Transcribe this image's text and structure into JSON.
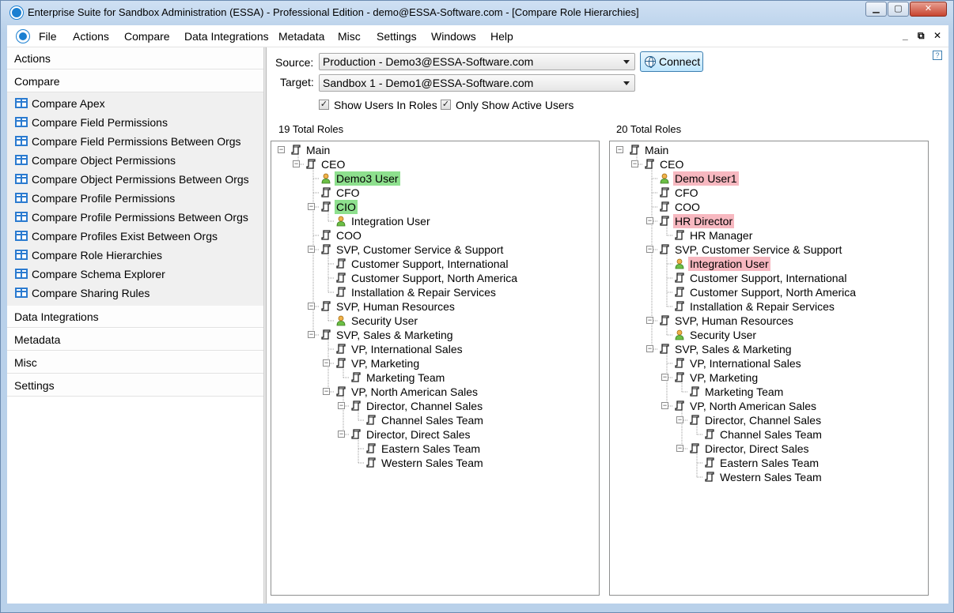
{
  "window": {
    "title": "Enterprise Suite for Sandbox Administration (ESSA) - Professional Edition - demo@ESSA-Software.com - [Compare Role Hierarchies]",
    "controls": {
      "minimize": "▁",
      "maximize": "▢",
      "close": "✕"
    }
  },
  "menubar": {
    "items": [
      "File",
      "Actions",
      "Compare",
      "Data Integrations",
      "Metadata",
      "Misc",
      "Settings",
      "Windows",
      "Help"
    ],
    "mdi_controls": [
      "_",
      "⧉",
      "✕"
    ]
  },
  "nav": {
    "headers": [
      "Actions",
      "Compare",
      "Data Integrations",
      "Metadata",
      "Misc",
      "Settings"
    ],
    "compare_items": [
      "Compare Apex",
      "Compare Field Permissions",
      "Compare Field Permissions Between Orgs",
      "Compare Object Permissions",
      "Compare Object Permissions Between Orgs",
      "Compare Profile Permissions",
      "Compare Profile Permissions Between Orgs",
      "Compare Profiles Exist Between Orgs",
      "Compare Role Hierarchies",
      "Compare Schema Explorer",
      "Compare Sharing Rules"
    ]
  },
  "form": {
    "source_label": "Source:",
    "source_value": "Production - Demo3@ESSA-Software.com",
    "target_label": "Target:",
    "target_value": "Sandbox 1 - Demo1@ESSA-Software.com",
    "connect_label": "Connect",
    "help": "?",
    "show_users_label": "Show Users In Roles",
    "show_users_checked": true,
    "only_active_label": "Only Show Active Users",
    "only_active_checked": true
  },
  "left_tree": {
    "count": "19 Total Roles",
    "nodes": [
      {
        "label": "Main",
        "level": 0,
        "type": "role",
        "expanded": true
      },
      {
        "label": "CEO",
        "level": 1,
        "type": "role",
        "expanded": true
      },
      {
        "label": "Demo3 User",
        "level": 2,
        "type": "user",
        "highlight": "green"
      },
      {
        "label": "CFO",
        "level": 2,
        "type": "role"
      },
      {
        "label": "CIO",
        "level": 2,
        "type": "role",
        "expanded": true,
        "highlight": "green"
      },
      {
        "label": "Integration User",
        "level": 3,
        "type": "user"
      },
      {
        "label": "COO",
        "level": 2,
        "type": "role"
      },
      {
        "label": "SVP, Customer Service & Support",
        "level": 2,
        "type": "role",
        "expanded": true
      },
      {
        "label": "Customer Support, International",
        "level": 3,
        "type": "role"
      },
      {
        "label": "Customer Support, North America",
        "level": 3,
        "type": "role"
      },
      {
        "label": "Installation & Repair Services",
        "level": 3,
        "type": "role"
      },
      {
        "label": "SVP, Human Resources",
        "level": 2,
        "type": "role",
        "expanded": true
      },
      {
        "label": "Security User",
        "level": 3,
        "type": "user"
      },
      {
        "label": "SVP, Sales & Marketing",
        "level": 2,
        "type": "role",
        "expanded": true
      },
      {
        "label": "VP, International Sales",
        "level": 3,
        "type": "role"
      },
      {
        "label": "VP, Marketing",
        "level": 3,
        "type": "role",
        "expanded": true
      },
      {
        "label": "Marketing Team",
        "level": 4,
        "type": "role"
      },
      {
        "label": "VP, North American Sales",
        "level": 3,
        "type": "role",
        "expanded": true
      },
      {
        "label": "Director, Channel Sales",
        "level": 4,
        "type": "role",
        "expanded": true
      },
      {
        "label": "Channel Sales Team",
        "level": 5,
        "type": "role"
      },
      {
        "label": "Director, Direct Sales",
        "level": 4,
        "type": "role",
        "expanded": true
      },
      {
        "label": "Eastern Sales Team",
        "level": 5,
        "type": "role"
      },
      {
        "label": "Western Sales Team",
        "level": 5,
        "type": "role"
      }
    ]
  },
  "right_tree": {
    "count": "20 Total Roles",
    "nodes": [
      {
        "label": "Main",
        "level": 0,
        "type": "role",
        "expanded": true
      },
      {
        "label": "CEO",
        "level": 1,
        "type": "role",
        "expanded": true
      },
      {
        "label": "Demo User1",
        "level": 2,
        "type": "user",
        "highlight": "red"
      },
      {
        "label": "CFO",
        "level": 2,
        "type": "role"
      },
      {
        "label": "COO",
        "level": 2,
        "type": "role"
      },
      {
        "label": "HR Director",
        "level": 2,
        "type": "role",
        "expanded": true,
        "highlight": "red"
      },
      {
        "label": "HR Manager",
        "level": 3,
        "type": "role"
      },
      {
        "label": "SVP, Customer Service & Support",
        "level": 2,
        "type": "role",
        "expanded": true
      },
      {
        "label": "Integration User",
        "level": 3,
        "type": "user",
        "highlight": "red"
      },
      {
        "label": "Customer Support, International",
        "level": 3,
        "type": "role"
      },
      {
        "label": "Customer Support, North America",
        "level": 3,
        "type": "role"
      },
      {
        "label": "Installation & Repair Services",
        "level": 3,
        "type": "role"
      },
      {
        "label": "SVP, Human Resources",
        "level": 2,
        "type": "role",
        "expanded": true
      },
      {
        "label": "Security User",
        "level": 3,
        "type": "user"
      },
      {
        "label": "SVP, Sales & Marketing",
        "level": 2,
        "type": "role",
        "expanded": true
      },
      {
        "label": "VP, International Sales",
        "level": 3,
        "type": "role"
      },
      {
        "label": "VP, Marketing",
        "level": 3,
        "type": "role",
        "expanded": true
      },
      {
        "label": "Marketing Team",
        "level": 4,
        "type": "role"
      },
      {
        "label": "VP, North American Sales",
        "level": 3,
        "type": "role",
        "expanded": true
      },
      {
        "label": "Director, Channel Sales",
        "level": 4,
        "type": "role",
        "expanded": true
      },
      {
        "label": "Channel Sales Team",
        "level": 5,
        "type": "role"
      },
      {
        "label": "Director, Direct Sales",
        "level": 4,
        "type": "role",
        "expanded": true
      },
      {
        "label": "Eastern Sales Team",
        "level": 5,
        "type": "role"
      },
      {
        "label": "Western Sales Team",
        "level": 5,
        "type": "role"
      }
    ]
  },
  "colors": {
    "added_highlight": "#8ee08e",
    "removed_highlight": "#f7b8c0",
    "accent": "#1a7fd1"
  }
}
